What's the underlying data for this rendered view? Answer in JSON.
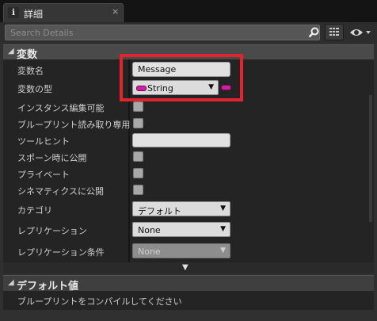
{
  "tab": {
    "title": "詳細",
    "close_glyph": "×",
    "icon": "info-icon"
  },
  "search": {
    "placeholder": "Search Details"
  },
  "toolbar": {
    "grid_icon": "property-matrix-icon",
    "eye_icon": "visibility-eye-icon"
  },
  "category": {
    "title": "変数",
    "expand_glyph": "◢"
  },
  "rows": [
    {
      "label": "変数名",
      "control": "text",
      "value": "Message"
    },
    {
      "label": "変数の型",
      "control": "type-dropdown",
      "value": "String"
    },
    {
      "label": "インスタンス編集可能",
      "control": "checkbox",
      "checked": false
    },
    {
      "label": "ブループリント読み取り専用",
      "control": "checkbox",
      "checked": false
    },
    {
      "label": "ツールヒント",
      "control": "text",
      "value": ""
    },
    {
      "label": "スポーン時に公開",
      "control": "checkbox",
      "checked": false
    },
    {
      "label": "プライベート",
      "control": "checkbox",
      "checked": false
    },
    {
      "label": "シネマティクスに公開",
      "control": "checkbox",
      "checked": false
    },
    {
      "label": "カテゴリ",
      "control": "dropdown",
      "value": "デフォルト"
    },
    {
      "label": "レプリケーション",
      "control": "dropdown",
      "value": "None"
    },
    {
      "label": "レプリケーション条件",
      "control": "dropdown",
      "value": "None",
      "disabled": true
    }
  ],
  "default_section": {
    "title": "デフォルト値",
    "message": "ブループリントをコンパイルしてください"
  },
  "colors": {
    "string_pin": "#d11fa2",
    "highlight": "#e3232f"
  }
}
